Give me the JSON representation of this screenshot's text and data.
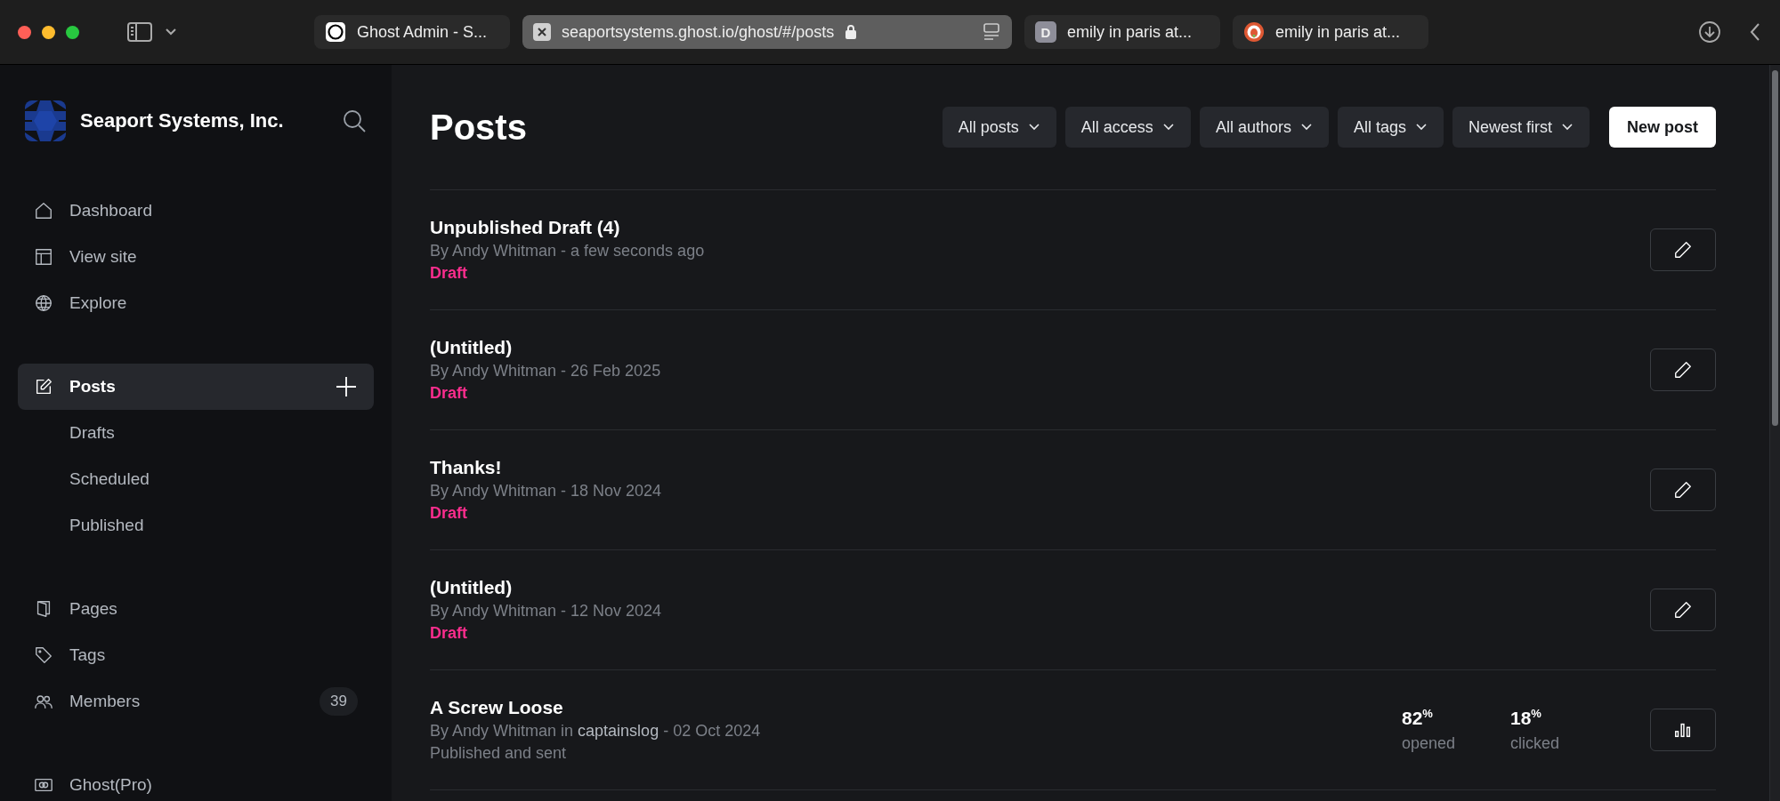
{
  "browser": {
    "tabs": [
      {
        "kind": "ghost",
        "label": "Ghost Admin - S...",
        "selected": false
      },
      {
        "kind": "site",
        "label": "seaportsystems.ghost.io/ghost/#/posts",
        "selected": true
      },
      {
        "kind": "letter",
        "badge": "D",
        "label": "emily in paris at...",
        "selected": false
      },
      {
        "kind": "duck",
        "label": "emily in paris at...",
        "selected": false
      }
    ]
  },
  "sidebar": {
    "brand": "Seaport Systems, Inc.",
    "groups": [
      {
        "items": [
          {
            "kind": "home",
            "label": "Dashboard",
            "selected": false
          },
          {
            "kind": "layout",
            "label": "View site",
            "selected": false
          },
          {
            "kind": "globe",
            "label": "Explore",
            "selected": false
          }
        ]
      },
      {
        "items": [
          {
            "kind": "edit",
            "label": "Posts",
            "selected": true,
            "children": [
              {
                "label": "Drafts",
                "selected": false
              },
              {
                "label": "Scheduled",
                "selected": false
              },
              {
                "label": "Published",
                "selected": false
              }
            ]
          }
        ]
      },
      {
        "items": [
          {
            "kind": "pages",
            "label": "Pages",
            "selected": false
          },
          {
            "kind": "tag",
            "label": "Tags",
            "selected": false
          },
          {
            "kind": "members",
            "label": "Members",
            "selected": false,
            "count": "39"
          }
        ]
      },
      {
        "items": [
          {
            "kind": "card",
            "label": "Ghost(Pro)",
            "selected": false
          }
        ]
      }
    ]
  },
  "page": {
    "title": "Posts",
    "filters": [
      "All posts",
      "All access",
      "All authors",
      "All tags",
      "Newest first"
    ],
    "new_button": "New post"
  },
  "posts": [
    {
      "title": "Unpublished Draft (4)",
      "meta": "By Andy Whitman - a few seconds ago",
      "status": "Draft",
      "kind": "draft"
    },
    {
      "title": "(Untitled)",
      "meta": "By Andy Whitman - 26 Feb 2025",
      "status": "Draft",
      "kind": "draft"
    },
    {
      "title": "Thanks!",
      "meta": "By Andy Whitman - 18 Nov 2024",
      "status": "Draft",
      "kind": "draft"
    },
    {
      "title": "(Untitled)",
      "meta": "By Andy Whitman - 12 Nov 2024",
      "status": "Draft",
      "kind": "draft"
    },
    {
      "title": "A Screw Loose",
      "meta": "By Andy Whitman in **captainslog** - 02 Oct 2024",
      "status": "Published and sent",
      "kind": "published",
      "stats": [
        {
          "value": "82$^{%}$",
          "label": "opened"
        },
        {
          "value": "18$^{%}$",
          "label": "clicked"
        }
      ]
    }
  ]
}
